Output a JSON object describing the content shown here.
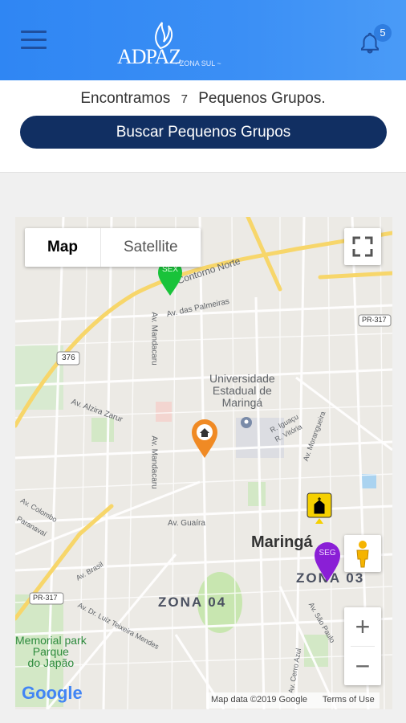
{
  "header": {
    "logo_text": "ADPAZ",
    "logo_sub": "~ ZONA SUL ~",
    "notification_count": "5"
  },
  "search": {
    "found_prefix": "Encontramos",
    "found_count": "7",
    "found_suffix": "Pequenos Grupos.",
    "button_label": "Buscar Pequenos Grupos"
  },
  "map": {
    "type_map": "Map",
    "type_satellite": "Satellite",
    "labels": {
      "contorno": "Contorno Norte",
      "palmeiras": "Av. das Palmeiras",
      "mandacaru1": "Av. Mandacaru",
      "mandacaru2": "Av. Mandacaru",
      "university": "Universidade\nEstadual de\nMaringá",
      "iguacu": "R. Iguaçu",
      "vitoria": "R. Vitória",
      "morangueira": "Av. Morangueira",
      "alzira": "Av. Alzira Zarur",
      "colombo": "Av. Colombo",
      "paranavai": "Paranavaí",
      "guaira": "Av. Guaíra",
      "maringa": "Maringá",
      "zona04": "ZONA 04",
      "zona03": "ZONA 03",
      "brasil": "Av. Brasil",
      "luiz": "Av. Dr. Luiz Teixeira Mendes",
      "park": "Memorial park\nParque\ndo Japão",
      "pr317a": "PR-317",
      "pr317b": "PR-317",
      "r376": "376",
      "sao_paulo": "Av. São Paulo",
      "cerro": "Av. Cerro Azul"
    },
    "markers": {
      "sex": "SEX",
      "seg": "SEG"
    },
    "google": "Google",
    "attribution": "Map data ©2019 Google",
    "terms": "Terms of Use",
    "zoom_in": "+",
    "zoom_out": "−",
    "colors": {
      "road_major": "#f7d66a",
      "marker_green": "#19c33a",
      "marker_orange": "#f08a24",
      "marker_purple": "#8a1fd6",
      "park": "#c8e6b0"
    }
  }
}
